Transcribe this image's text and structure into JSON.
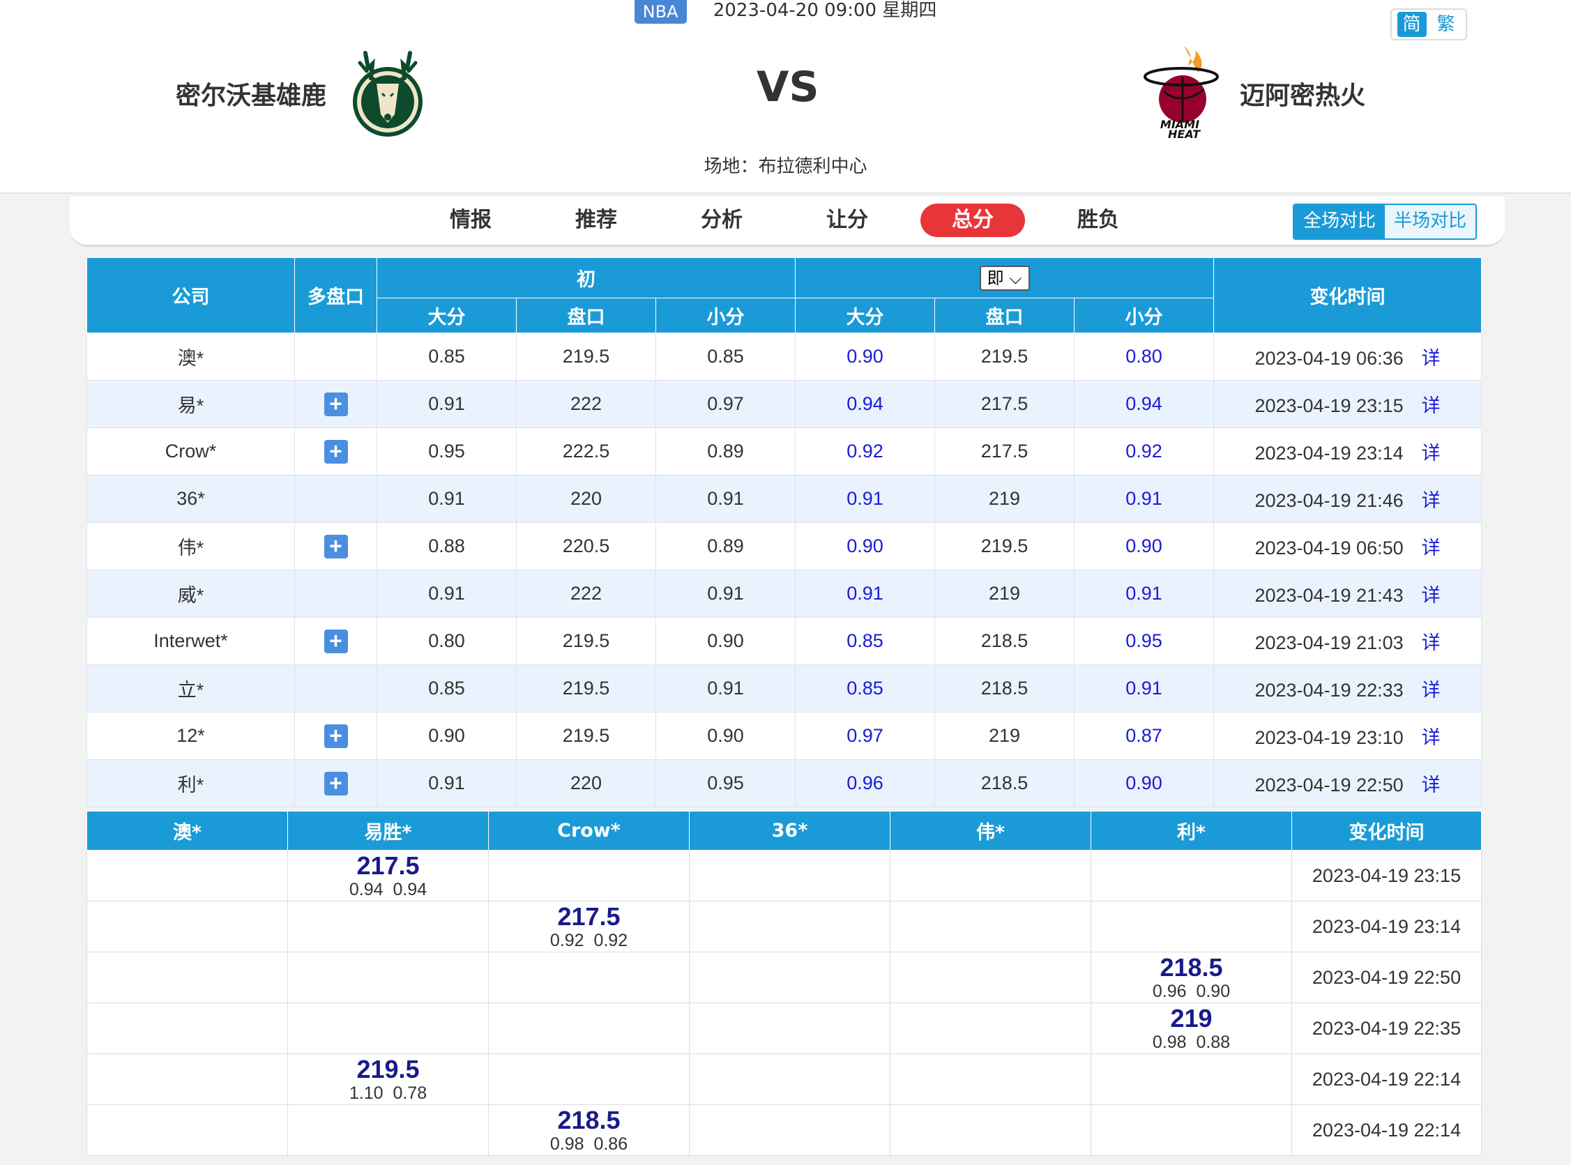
{
  "match": {
    "league": "NBA",
    "datetime": "2023-04-20 09:00 星期四",
    "home_team": "密尔沃基雄鹿",
    "away_team": "迈阿密热火",
    "vs": "VS",
    "venue": "场地：布拉德利中心",
    "home_logo": "milwaukee-bucks-logo",
    "away_logo": "miami-heat-logo"
  },
  "lang": {
    "simplified": "简",
    "traditional": "繁"
  },
  "nav": {
    "tabs": [
      {
        "label": "情报"
      },
      {
        "label": "推荐"
      },
      {
        "label": "分析"
      },
      {
        "label": "让分"
      },
      {
        "label": "总分",
        "active": true
      },
      {
        "label": "胜负"
      }
    ],
    "compare": {
      "full": "全场对比",
      "half": "半场对比"
    }
  },
  "odds": {
    "headers": {
      "company": "公司",
      "multi": "多盘口",
      "initial": "初",
      "live": "即",
      "over": "大分",
      "line": "盘口",
      "under": "小分",
      "change_time": "变化时间"
    },
    "detail_label": "详",
    "rows": [
      {
        "company": "澳*",
        "multi": false,
        "init": [
          "0.85",
          "219.5",
          "0.85"
        ],
        "live": [
          "0.90",
          "219.5",
          "0.80"
        ],
        "time": "2023-04-19 06:36"
      },
      {
        "company": "易*",
        "multi": true,
        "init": [
          "0.91",
          "222",
          "0.97"
        ],
        "live": [
          "0.94",
          "217.5",
          "0.94"
        ],
        "time": "2023-04-19 23:15"
      },
      {
        "company": "Crow*",
        "multi": true,
        "init": [
          "0.95",
          "222.5",
          "0.89"
        ],
        "live": [
          "0.92",
          "217.5",
          "0.92"
        ],
        "time": "2023-04-19 23:14"
      },
      {
        "company": "36*",
        "multi": false,
        "init": [
          "0.91",
          "220",
          "0.91"
        ],
        "live": [
          "0.91",
          "219",
          "0.91"
        ],
        "time": "2023-04-19 21:46"
      },
      {
        "company": "伟*",
        "multi": true,
        "init": [
          "0.88",
          "220.5",
          "0.89"
        ],
        "live": [
          "0.90",
          "219.5",
          "0.90"
        ],
        "time": "2023-04-19 06:50"
      },
      {
        "company": "威*",
        "multi": false,
        "init": [
          "0.91",
          "222",
          "0.91"
        ],
        "live": [
          "0.91",
          "219",
          "0.91"
        ],
        "time": "2023-04-19 21:43"
      },
      {
        "company": "Interwet*",
        "multi": true,
        "init": [
          "0.80",
          "219.5",
          "0.90"
        ],
        "live": [
          "0.85",
          "218.5",
          "0.95"
        ],
        "time": "2023-04-19 21:03"
      },
      {
        "company": "立*",
        "multi": false,
        "init": [
          "0.85",
          "219.5",
          "0.91"
        ],
        "live": [
          "0.85",
          "218.5",
          "0.91"
        ],
        "time": "2023-04-19 22:33"
      },
      {
        "company": "12*",
        "multi": true,
        "init": [
          "0.90",
          "219.5",
          "0.90"
        ],
        "live": [
          "0.97",
          "219",
          "0.87"
        ],
        "time": "2023-04-19 23:10"
      },
      {
        "company": "利*",
        "multi": true,
        "init": [
          "0.91",
          "220",
          "0.95"
        ],
        "live": [
          "0.96",
          "218.5",
          "0.90"
        ],
        "time": "2023-04-19 22:50"
      }
    ]
  },
  "history": {
    "headers": [
      "澳*",
      "易胜*",
      "Crow*",
      "36*",
      "伟*",
      "利*",
      "变化时间"
    ],
    "rows": [
      {
        "col": 1,
        "line": "217.5",
        "odds": "0.94  0.94",
        "time": "2023-04-19 23:15"
      },
      {
        "col": 2,
        "line": "217.5",
        "odds": "0.92  0.92",
        "time": "2023-04-19 23:14"
      },
      {
        "col": 5,
        "line": "218.5",
        "odds": "0.96  0.90",
        "time": "2023-04-19 22:50"
      },
      {
        "col": 5,
        "line": "219",
        "odds": "0.98  0.88",
        "time": "2023-04-19 22:35"
      },
      {
        "col": 1,
        "line": "219.5",
        "odds": "1.10  0.78",
        "time": "2023-04-19 22:14"
      },
      {
        "col": 2,
        "line": "218.5",
        "odds": "0.98  0.86",
        "time": "2023-04-19 22:14"
      }
    ]
  }
}
